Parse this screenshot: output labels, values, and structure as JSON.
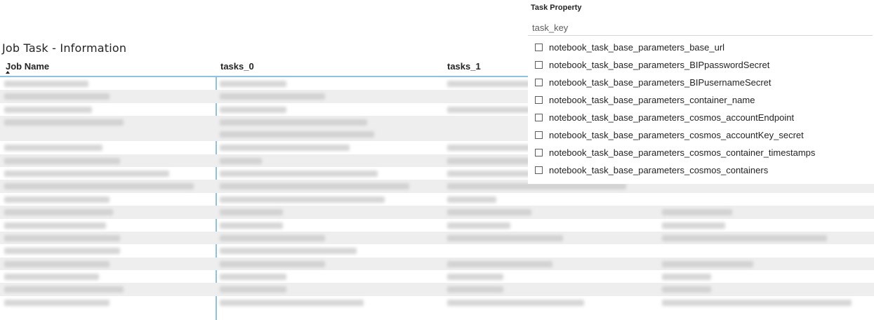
{
  "table": {
    "title": "Job Task - Information",
    "columns": [
      "Job Name",
      "tasks_0",
      "tasks_1"
    ],
    "rows": [
      [
        "",
        "",
        "",
        ""
      ],
      [
        "",
        "",
        "",
        ""
      ],
      [
        "",
        "",
        "",
        ""
      ],
      [
        "",
        "",
        "",
        ""
      ],
      [
        "",
        "",
        "",
        ""
      ],
      [
        "",
        "",
        "",
        ""
      ],
      [
        "",
        "",
        "",
        ""
      ],
      [
        "",
        "",
        "",
        ""
      ],
      [
        "",
        "",
        "",
        ""
      ],
      [
        "",
        "",
        "",
        ""
      ],
      [
        "",
        "",
        "",
        ""
      ],
      [
        "",
        "",
        "",
        ""
      ],
      [
        "",
        "",
        "",
        ""
      ],
      [
        "",
        "",
        "",
        ""
      ],
      [
        "",
        "",
        "",
        ""
      ],
      [
        "",
        "",
        "",
        ""
      ],
      [
        "",
        "",
        "",
        ""
      ],
      [
        "",
        "",
        "",
        ""
      ]
    ]
  },
  "slicer": {
    "title": "Task Property",
    "search_value": "task_key",
    "items": [
      "notebook_task_base_parameters_base_url",
      "notebook_task_base_parameters_BIPpasswordSecret",
      "notebook_task_base_parameters_BIPusernameSecret",
      "notebook_task_base_parameters_container_name",
      "notebook_task_base_parameters_cosmos_accountEndpoint",
      "notebook_task_base_parameters_cosmos_accountKey_secret",
      "notebook_task_base_parameters_cosmos_container_timestamps",
      "notebook_task_base_parameters_cosmos_containers"
    ]
  },
  "colors": {
    "header_underline": "#8fc1e3",
    "row_alt": "#eeeeee",
    "text": "#252423"
  }
}
